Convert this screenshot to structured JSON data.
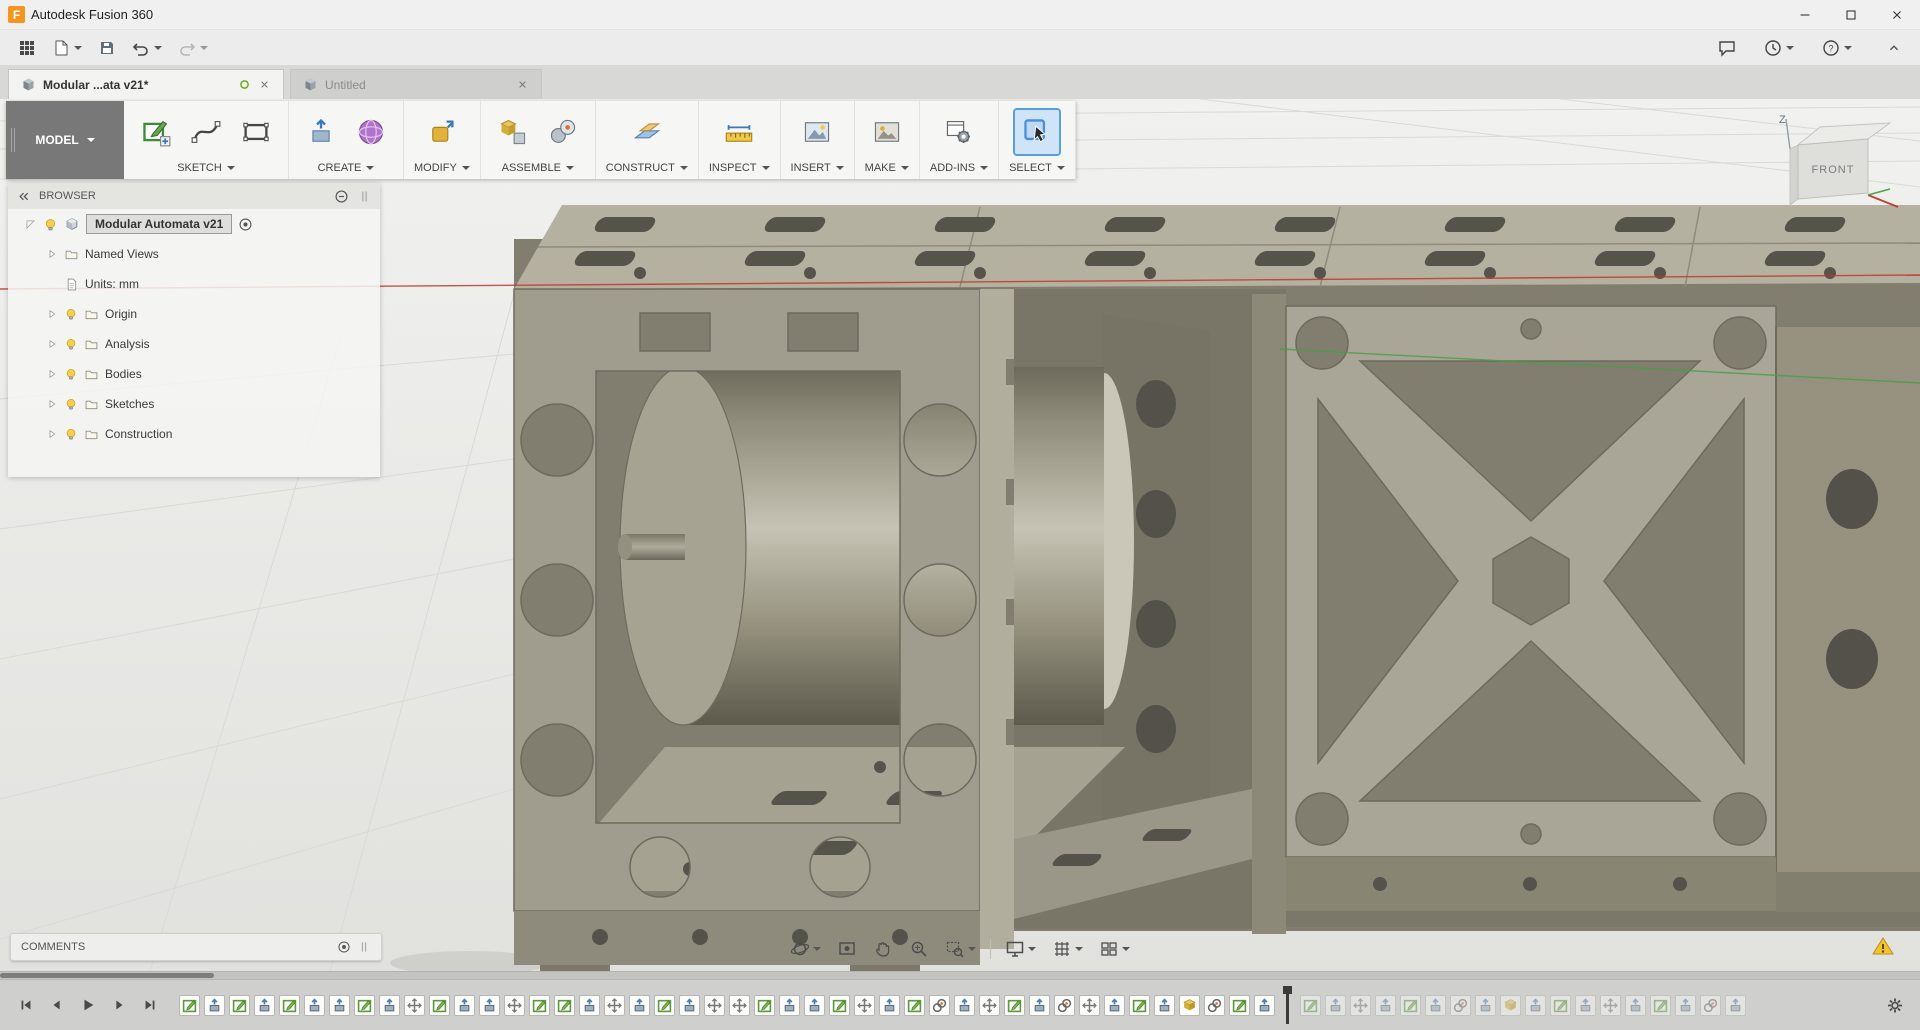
{
  "titlebar": {
    "app_icon": "fusion-logo",
    "title": "Autodesk Fusion 360",
    "window_buttons": [
      "minimize",
      "maximize",
      "close"
    ]
  },
  "qat": {
    "left": [
      {
        "icon": "app-grid"
      },
      {
        "icon": "file-doc",
        "caret": true
      },
      {
        "icon": "save-floppy"
      },
      {
        "icon": "undo-arrow",
        "caret": true
      },
      {
        "icon": "redo-arrow",
        "caret": true,
        "disabled": true
      }
    ],
    "right": [
      {
        "icon": "comment-bubble"
      },
      {
        "icon": "clock",
        "caret": true
      },
      {
        "icon": "help-circle",
        "caret": true
      }
    ],
    "collapse_icon": "chevron-up"
  },
  "tabs": [
    {
      "label": "Modular ...ata v21*",
      "active": true,
      "status_icon": "green-ring"
    },
    {
      "label": "Untitled",
      "active": false
    }
  ],
  "ribbon": {
    "workspace_label": "MODEL",
    "groups": [
      {
        "label": "SKETCH",
        "icons": [
          "sketch-create",
          "spline",
          "rect-tool"
        ]
      },
      {
        "label": "CREATE",
        "icons": [
          "extrude",
          "form-sphere"
        ]
      },
      {
        "label": "MODIFY",
        "icons": [
          "press-pull"
        ]
      },
      {
        "label": "ASSEMBLE",
        "icons": [
          "component",
          "joint"
        ]
      },
      {
        "label": "CONSTRUCT",
        "icons": [
          "plane-construct"
        ]
      },
      {
        "label": "INSPECT",
        "icons": [
          "measure"
        ]
      },
      {
        "label": "INSERT",
        "icons": [
          "canvas-img"
        ]
      },
      {
        "label": "MAKE",
        "icons": [
          "make-print"
        ]
      },
      {
        "label": "ADD-INS",
        "icons": [
          "addins-gear"
        ]
      },
      {
        "label": "SELECT",
        "icons": [
          "select-cursor"
        ],
        "highlighted": true
      }
    ]
  },
  "browser": {
    "title": "BROWSER",
    "collapse_icon": "double-chevron-left",
    "options_icon": "minus-circle",
    "root": {
      "label": "Modular Automata v21",
      "expand_icon": "corner-tri",
      "bulb_icon": "bulb",
      "doc_icon": "cube-doc",
      "target_icon": "target-circle"
    },
    "items": [
      {
        "label": "Named Views",
        "arrow": true,
        "bulb": false,
        "icon": "folder"
      },
      {
        "label": "Units: mm",
        "arrow": false,
        "bulb": false,
        "icon": "document"
      },
      {
        "label": "Origin",
        "arrow": true,
        "bulb": true,
        "icon": "folder"
      },
      {
        "label": "Analysis",
        "arrow": true,
        "bulb": true,
        "icon": "folder"
      },
      {
        "label": "Bodies",
        "arrow": true,
        "bulb": true,
        "icon": "folder"
      },
      {
        "label": "Sketches",
        "arrow": true,
        "bulb": true,
        "icon": "folder"
      },
      {
        "label": "Construction",
        "arrow": true,
        "bulb": true,
        "icon": "folder"
      }
    ]
  },
  "viewcube": {
    "front_label": "FRONT",
    "z_label": "Z"
  },
  "comments": {
    "label": "COMMENTS",
    "icons": [
      "target-circle",
      "grip-v"
    ]
  },
  "navbar": {
    "buttons": [
      {
        "name": "orbit",
        "caret": true
      },
      {
        "name": "look-at"
      },
      {
        "name": "pan-hand"
      },
      {
        "name": "zoom-mag"
      },
      {
        "name": "zoom-window",
        "caret": true
      },
      {
        "name": "separator"
      },
      {
        "name": "display-monitor",
        "caret": true
      },
      {
        "name": "grid-display",
        "caret": true
      },
      {
        "name": "viewports",
        "caret": true
      }
    ]
  },
  "viewport": {
    "warning_icon": "warning-triangle"
  },
  "timeline": {
    "playback": [
      "go-to-start",
      "step-back",
      "play",
      "step-forward",
      "go-to-end"
    ],
    "features_active": [
      "sketch",
      "extrude",
      "sketch",
      "extrude",
      "sketch",
      "extrude",
      "extrude",
      "sketch",
      "extrude",
      "move",
      "sketch",
      "extrude",
      "extrude",
      "move",
      "sketch",
      "sketch",
      "extrude",
      "move",
      "extrude",
      "sketch",
      "extrude",
      "move",
      "move",
      "sketch",
      "extrude",
      "extrude",
      "sketch",
      "move",
      "extrude",
      "sketch",
      "joint",
      "extrude",
      "move",
      "sketch",
      "extrude",
      "joint",
      "move",
      "extrude",
      "sketch",
      "extrude",
      "component",
      "joint",
      "sketch",
      "extrude"
    ],
    "features_suppressed": [
      "sketch",
      "extrude",
      "move",
      "extrude",
      "sketch",
      "extrude",
      "joint",
      "extrude",
      "component",
      "extrude",
      "sketch",
      "extrude",
      "move",
      "extrude",
      "sketch",
      "extrude",
      "joint",
      "extrude"
    ],
    "settings_icon": "gear"
  },
  "colors": {
    "accent_blue": "#4a90d9",
    "model_tan": "#a19d8e",
    "axis_red": "#c0392b",
    "axis_green": "#44a044",
    "warning_yellow": "#f2c230"
  }
}
